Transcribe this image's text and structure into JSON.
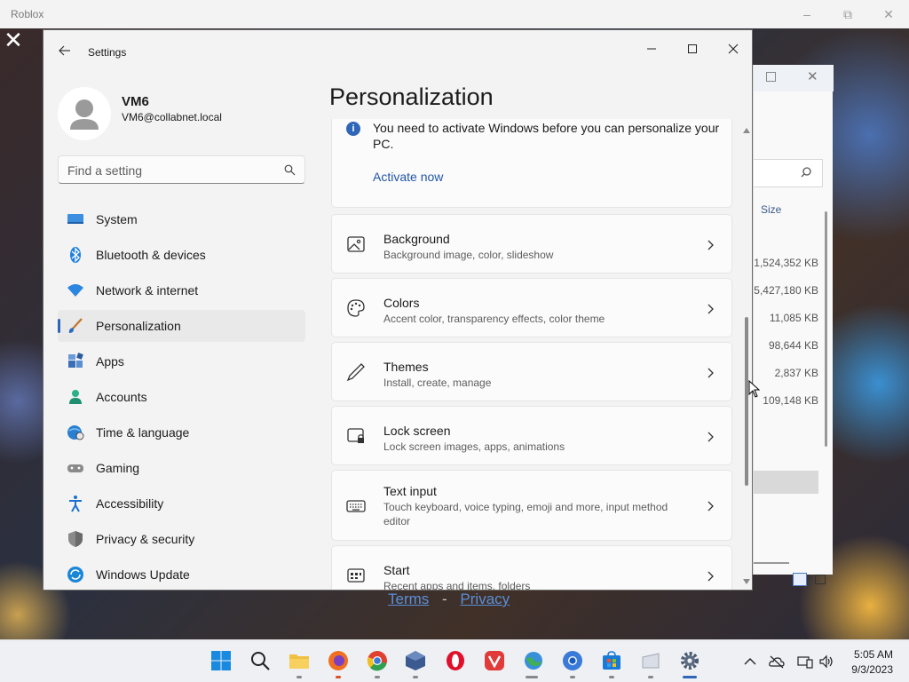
{
  "roblox": {
    "title": "Roblox",
    "links": {
      "terms": "Terms",
      "separator": "-",
      "privacy": "Privacy"
    }
  },
  "explorer": {
    "size_header": "Size",
    "sizes": [
      "1,524,352 KB",
      "5,427,180 KB",
      "11,085 KB",
      "98,644 KB",
      "2,837 KB",
      "109,148 KB"
    ]
  },
  "settings": {
    "app_title": "Settings",
    "user": {
      "name": "VM6",
      "email": "VM6@collabnet.local"
    },
    "search": {
      "placeholder": "Find a setting"
    },
    "nav": [
      {
        "label": "System",
        "icon": "monitor-icon"
      },
      {
        "label": "Bluetooth & devices",
        "icon": "bluetooth-icon"
      },
      {
        "label": "Network & internet",
        "icon": "wifi-icon"
      },
      {
        "label": "Personalization",
        "icon": "brush-icon",
        "active": true
      },
      {
        "label": "Apps",
        "icon": "apps-icon"
      },
      {
        "label": "Accounts",
        "icon": "person-icon"
      },
      {
        "label": "Time & language",
        "icon": "globe-clock-icon"
      },
      {
        "label": "Gaming",
        "icon": "gamepad-icon"
      },
      {
        "label": "Accessibility",
        "icon": "accessibility-icon"
      },
      {
        "label": "Privacy & security",
        "icon": "shield-icon"
      },
      {
        "label": "Windows Update",
        "icon": "update-icon"
      }
    ],
    "page_title": "Personalization",
    "activation": {
      "message": "You need to activate Windows before you can personalize your PC.",
      "link": "Activate now"
    },
    "items": [
      {
        "title": "Background",
        "desc": "Background image, color, slideshow",
        "icon": "picture-icon"
      },
      {
        "title": "Colors",
        "desc": "Accent color, transparency effects, color theme",
        "icon": "palette-icon"
      },
      {
        "title": "Themes",
        "desc": "Install, create, manage",
        "icon": "pen-icon"
      },
      {
        "title": "Lock screen",
        "desc": "Lock screen images, apps, animations",
        "icon": "lock-screen-icon"
      },
      {
        "title": "Text input",
        "desc": "Touch keyboard, voice typing, emoji and more, input method editor",
        "icon": "keyboard-icon"
      },
      {
        "title": "Start",
        "desc": "Recent apps and items, folders",
        "icon": "start-icon"
      }
    ]
  },
  "taskbar": {
    "time": "5:05 AM",
    "date": "9/3/2023"
  },
  "colors": {
    "accent": "#2f66b8",
    "link": "#2056a8"
  }
}
